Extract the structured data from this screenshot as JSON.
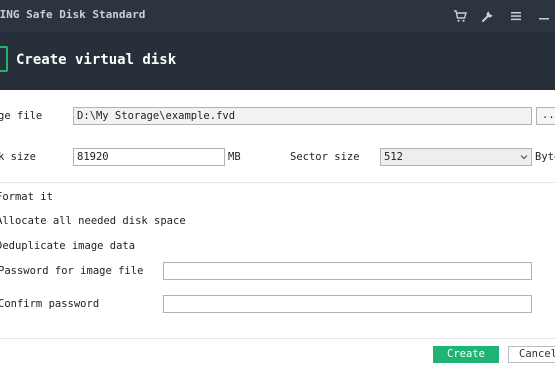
{
  "window": {
    "title": "LING Safe Disk Standard",
    "icons": [
      "cart-icon",
      "wrench-icon",
      "menu-icon",
      "minimize-icon"
    ]
  },
  "header": {
    "title": "Create virtual disk",
    "accent_color": "#25b36e"
  },
  "form": {
    "image_file_label": "ge file",
    "image_file_value": "D:\\My Storage\\example.fvd",
    "browse_label": "...",
    "disk_size_label": "k size",
    "disk_size_value": "81920",
    "disk_size_unit": "MB",
    "sector_size_label": "Sector size",
    "sector_size_value": "512",
    "sector_size_unit": "Byte",
    "format_label": "Format it",
    "allocate_label": "Allocate all needed disk space",
    "dedup_label": "Deduplicate image data",
    "password_label": "Password for image file",
    "password_value": "",
    "confirm_label": "Confirm password",
    "confirm_value": ""
  },
  "footer": {
    "create_label": "Create",
    "cancel_label": "Cancel",
    "primary_color": "#1fb475"
  }
}
